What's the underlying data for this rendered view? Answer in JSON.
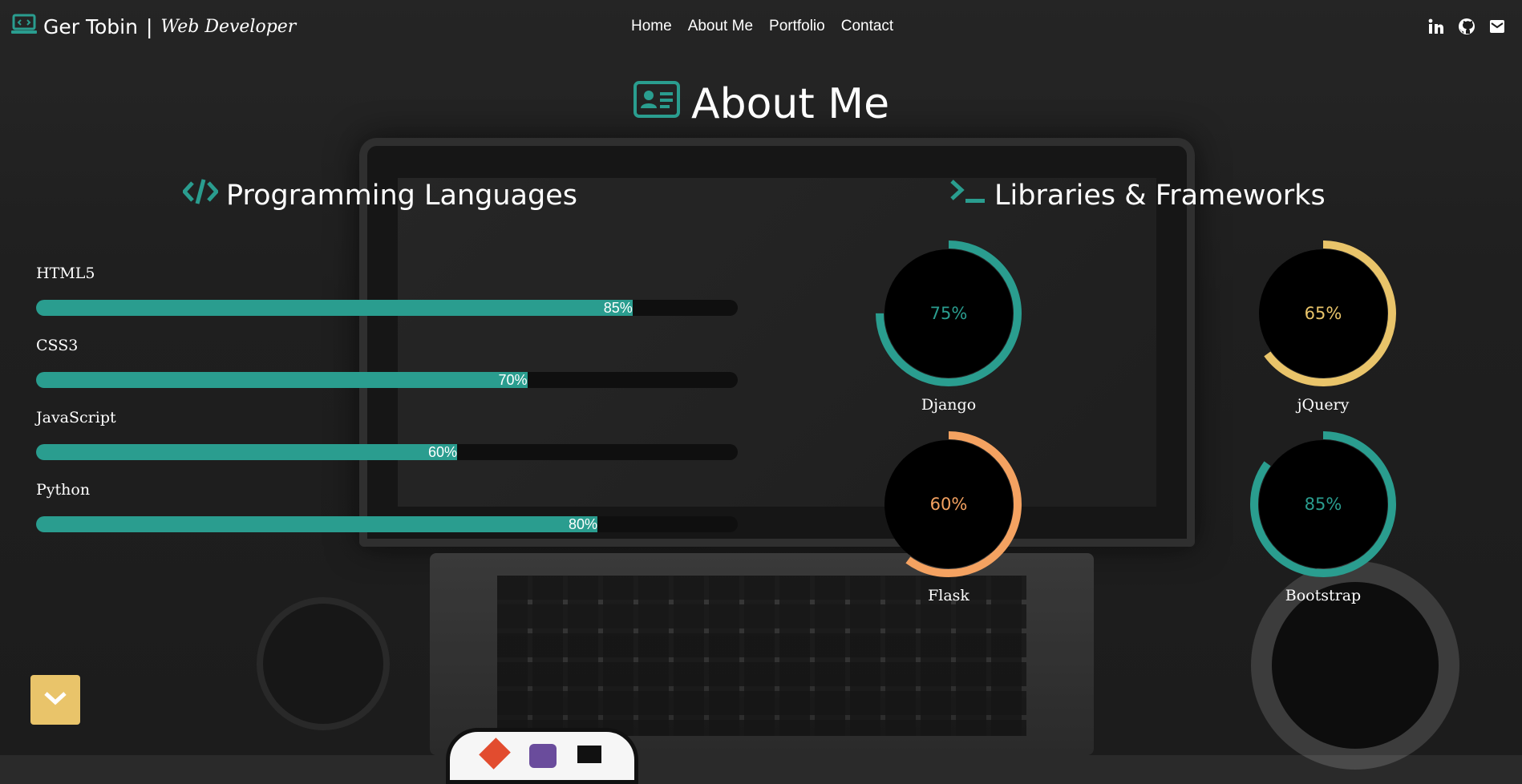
{
  "brand": {
    "name": "Ger Tobin",
    "separator": "|",
    "role": "Web Developer"
  },
  "nav": {
    "links": [
      "Home",
      "About Me",
      "Portfolio",
      "Contact"
    ]
  },
  "social": [
    "linkedin-icon",
    "github-icon",
    "email-icon"
  ],
  "section": {
    "title": "About Me"
  },
  "languages": {
    "title": "Programming Languages",
    "items": [
      {
        "label": "HTML5",
        "percent": 85,
        "pct_text": "85%"
      },
      {
        "label": "CSS3",
        "percent": 70,
        "pct_text": "70%"
      },
      {
        "label": "JavaScript",
        "percent": 60,
        "pct_text": "60%"
      },
      {
        "label": "Python",
        "percent": 80,
        "pct_text": "80%"
      }
    ]
  },
  "frameworks": {
    "title": "Libraries & Frameworks",
    "items": [
      {
        "label": "Django",
        "percent": 75,
        "pct_text": "75%",
        "color": "#2a9d8f"
      },
      {
        "label": "jQuery",
        "percent": 65,
        "pct_text": "65%",
        "color": "#e9c46a"
      },
      {
        "label": "Flask",
        "percent": 60,
        "pct_text": "60%",
        "color": "#f4a261"
      },
      {
        "label": "Bootstrap",
        "percent": 85,
        "pct_text": "85%",
        "color": "#2a9d8f"
      }
    ]
  },
  "colors": {
    "accent": "#2a9d8f",
    "yellow": "#e9c46a",
    "orange": "#f4a261",
    "track": "#0f0f0f"
  }
}
